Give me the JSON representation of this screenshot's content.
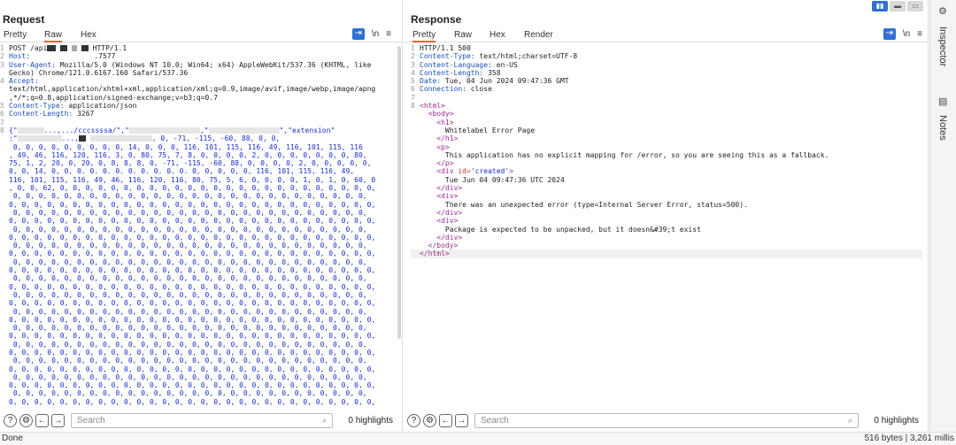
{
  "request": {
    "title": "Request",
    "tabs": [
      "Pretty",
      "Raw",
      "Hex"
    ],
    "active_tab": "Raw",
    "lines": [
      {
        "n": "1",
        "segments": [
          {
            "t": "POST /api"
          },
          {
            "redact": 10
          },
          {
            "t": " "
          },
          {
            "redact": 8
          },
          {
            "t": " "
          },
          {
            "redact": 6,
            "light": true
          },
          {
            "t": " "
          },
          {
            "redact": 8
          },
          {
            "t": " HTTP/1.1"
          }
        ]
      },
      {
        "n": "2",
        "segments": [
          {
            "t": "Host: ",
            "cls": "kh"
          },
          {
            "t": "              .7577"
          }
        ]
      },
      {
        "n": "3",
        "segments": [
          {
            "t": "User-Agent: ",
            "cls": "kh"
          },
          {
            "t": "Mozilla/5.0 (Windows NT 10.0; Win64; x64) AppleWebKit/537.36 (KHTML, like"
          }
        ]
      },
      {
        "n": "",
        "segments": [
          {
            "t": "Gecko) Chrome/121.0.6167.160 Safari/537.36"
          }
        ]
      },
      {
        "n": "4",
        "segments": [
          {
            "t": "Accept:",
            "cls": "kh"
          }
        ]
      },
      {
        "n": "",
        "segments": [
          {
            "t": "text/html,application/xhtml+xml,application/xml;q=0.9,image/avif,image/webp,image/apng"
          }
        ]
      },
      {
        "n": "",
        "segments": [
          {
            "t": ",*/*;q=0.8,application/signed-exchange;v=b3;q=0.7"
          }
        ]
      },
      {
        "n": "5",
        "segments": [
          {
            "t": "Content-Type: ",
            "cls": "kh"
          },
          {
            "t": "application/json"
          }
        ]
      },
      {
        "n": "6",
        "segments": [
          {
            "t": "Content-Length: ",
            "cls": "kh"
          },
          {
            "t": "3267"
          }
        ]
      },
      {
        "n": "7",
        "segments": []
      },
      {
        "n": "8",
        "segments": [
          {
            "t": "{\"",
            "cls": "blue"
          },
          {
            "redact": 30,
            "white": true
          },
          {
            "t": "...,.../cccssssa/\",\"",
            "cls": "blue"
          },
          {
            "redact": 80,
            "white": true
          },
          {
            "t": ",\"",
            "cls": "blue"
          },
          {
            "redact": 80,
            "white": true
          },
          {
            "t": "\",\"extension\"",
            "cls": "blue"
          }
        ]
      },
      {
        "n": "",
        "segments": [
          {
            "t": ":\"",
            "cls": "blue"
          },
          {
            "redact": 50,
            "white": true
          },
          {
            "t": "...,",
            "cls": "blue"
          },
          {
            "redact": 8
          },
          {
            "t": " ",
            "cls": "blue"
          },
          {
            "redact": 70,
            "white": true
          },
          {
            "t": ", 0, -71, -115, -60, 88, 0, 0,",
            "cls": "blue"
          }
        ]
      },
      {
        "n": "",
        "segments": [
          {
            "t": " 0, 0, 0, 0, 0, 0, 0, 0, 0, 14, 0, 0, 0, 116, 101, 115, 116, 49, 116, 101, 115, 116",
            "cls": "blue"
          }
        ]
      },
      {
        "n": "",
        "segments": [
          {
            "t": ", 49, 46, 116, 120, 116, 3, 0, 80, 75, 7, 8, 0, 0, 0, 0, 2, 0, 0, 0, 0, 0, 0, 0, 80,",
            "cls": "blue"
          }
        ]
      },
      {
        "n": "",
        "segments": [
          {
            "t": "75, 1, 2, 20, 0, 20, 0, 8, 8, 8, 0, -71, -115, -60, 88, 0, 0, 0, 0, 2, 0, 0, 0, 0, 0,",
            "cls": "blue"
          }
        ]
      },
      {
        "n": "",
        "segments": [
          {
            "t": "0, 0, 14, 0, 0, 0. 0. 0. 0. 0. 0. 0. 0. 0. 0, 0, 0, 0, 0, 116, 101, 115, 116, 49,",
            "cls": "blue"
          }
        ]
      },
      {
        "n": "",
        "segments": [
          {
            "t": "116, 101, 115, 116, 49, 46, 116, 120, 116, 80, 75, 5, 6, 0, 0, 0, 0, 1, 0, 1, 0, 60, 0",
            "cls": "blue"
          }
        ]
      },
      {
        "n": "",
        "segments": [
          {
            "t": ", 0, 0, 62, 0, 0, 0, 0, 0, 0, 0, 0, 0, 0, 0, 0, 0, 0, 0, 0, 0, 0, 0, 0, 0, 0, 0, 0, 0,",
            "cls": "blue"
          }
        ]
      },
      {
        "n": "",
        "segments": [
          {
            "t": " 0, 0, 0, 0, 0, 0, 0, 0, 0, 0, 0, 0, 0, 0, 0, 0, 0, 0, 0, 0, 0, 0, 0, 0, 0, 0, 0, 0,",
            "cls": "blue"
          }
        ]
      },
      {
        "n": "",
        "segments": [
          {
            "t": "0, 0, 0, 0, 0, 0, 0, 0, 0, 0, 0, 0, 0, 0, 0, 0, 0, 0, 0, 0, 0, 0, 0, 0, 0, 0, 0, 0, 0,",
            "cls": "blue"
          }
        ]
      },
      {
        "n": "",
        "segments": [
          {
            "t": " 0, 0, 0, 0, 0, 0, 0, 0, 0, 0, 0, 0, 0, 0, 0, 0, 0, 0, 0, 0, 0, 0, 0, 0, 0, 0, 0, 0,",
            "cls": "blue"
          }
        ]
      },
      {
        "n": "",
        "segments": [
          {
            "t": "0, 0, 0, 0, 0, 0, 0, 0, 0, 0, 0, 0, 0, 0, 0, 0, 0, 0, 0, 0, 0, 0, 0, 0, 0, 0, 0, 0, 0,",
            "cls": "blue"
          }
        ]
      },
      {
        "n": "",
        "segments": [
          {
            "t": " 0, 0, 0, 0, 0, 0, 0, 0, 0, 0, 0, 0, 0, 0, 0, 0, 0, 0, 0, 0, 0, 0, 0, 0, 0, 0, 0, 0,",
            "cls": "blue"
          }
        ]
      },
      {
        "n": "",
        "segments": [
          {
            "t": "0, 0, 0, 0, 0, 0, 0, 0, 0, 0, 0, 0, 0, 0, 0, 0, 0, 0, 0, 0, 0, 0, 0, 0, 0, 0, 0, 0, 0,",
            "cls": "blue"
          }
        ]
      },
      {
        "n": "",
        "segments": [
          {
            "t": " 0, 0, 0, 0, 0, 0, 0, 0, 0, 0, 0, 0, 0, 0, 0, 0, 0, 0, 0, 0, 0, 0, 0, 0, 0, 0, 0, 0,",
            "cls": "blue"
          }
        ]
      },
      {
        "n": "",
        "segments": [
          {
            "t": "0, 0, 0, 0, 0, 0, 0, 0, 0, 0, 0, 0, 0, 0, 0, 0, 0, 0, 0, 0, 0, 0, 0, 0, 0, 0, 0, 0, 0,",
            "cls": "blue"
          }
        ]
      },
      {
        "n": "",
        "segments": [
          {
            "t": " 0, 0, 0, 0, 0, 0, 0, 0, 0, 0, 0, 0, 0, 0, 0, 0, 0, 0, 0, 0, 0, 0, 0, 0, 0, 0, 0, 0,",
            "cls": "blue"
          }
        ]
      },
      {
        "n": "",
        "segments": [
          {
            "t": "0, 0, 0, 0, 0, 0, 0, 0, 0, 0, 0, 0, 0, 0, 0, 0, 0, 0, 0, 0, 0, 0, 0, 0, 0, 0, 0, 0, 0,",
            "cls": "blue"
          }
        ]
      },
      {
        "n": "",
        "segments": [
          {
            "t": " 0, 0, 0, 0, 0, 0, 0, 0, 0, 0, 0, 0, 0, 0, 0, 0, 0, 0, 0, 0, 0, 0, 0, 0, 0, 0, 0, 0,",
            "cls": "blue"
          }
        ]
      },
      {
        "n": "",
        "segments": [
          {
            "t": "0, 0, 0, 0, 0, 0, 0, 0, 0, 0, 0, 0, 0, 0, 0, 0, 0, 0, 0, 0, 0, 0, 0, 0, 0, 0, 0, 0, 0,",
            "cls": "blue"
          }
        ]
      },
      {
        "n": "",
        "segments": [
          {
            "t": " 0, 0, 0, 0, 0, 0, 0, 0, 0, 0, 0, 0, 0, 0, 0, 0, 0, 0, 0, 0, 0, 0, 0, 0, 0, 0, 0, 0,",
            "cls": "blue"
          }
        ]
      },
      {
        "n": "",
        "segments": [
          {
            "t": "0, 0, 0, 0, 0, 0, 0, 0, 0, 0, 0, 0, 0, 0, 0, 0, 0, 0, 0, 0, 0, 0, 0, 0, 0, 0, 0, 0, 0,",
            "cls": "blue"
          }
        ]
      },
      {
        "n": "",
        "segments": [
          {
            "t": " 0, 0, 0, 0, 0, 0, 0, 0, 0, 0, 0, 0, 0, 0, 0, 0, 0, 0, 0, 0, 0, 0, 0, 0, 0, 0, 0, 0,",
            "cls": "blue"
          }
        ]
      },
      {
        "n": "",
        "segments": [
          {
            "t": "0, 0, 0, 0, 0, 0, 0, 0, 0, 0, 0, 0, 0, 0, 0, 0, 0, 0, 0, 0, 0, 0, 0, 0, 0, 0, 0, 0, 0,",
            "cls": "blue"
          }
        ]
      },
      {
        "n": "",
        "segments": [
          {
            "t": " 0, 0, 0, 0, 0, 0, 0, 0, 0, 0, 0, 0, 0, 0, 0, 0, 0, 0, 0, 0, 0, 0, 0, 0, 0, 0, 0, 0,",
            "cls": "blue"
          }
        ]
      },
      {
        "n": "",
        "segments": [
          {
            "t": "0, 0, 0, 0, 0, 0, 0, 0, 0, 0, 0, 0, 0, 0, 0, 0, 0, 0, 0, 0, 0, 0, 0, 0, 0, 0, 0, 0, 0,",
            "cls": "blue"
          }
        ]
      },
      {
        "n": "",
        "segments": [
          {
            "t": " 0, 0, 0, 0, 0, 0, 0, 0, 0, 0, 0, 0, 0, 0, 0, 0, 0, 0, 0, 0, 0, 0, 0, 0, 0, 0, 0, 0,",
            "cls": "blue"
          }
        ]
      },
      {
        "n": "",
        "segments": [
          {
            "t": "0, 0, 0, 0, 0, 0, 0, 0, 0, 0, 0, 0, 0, 0, 0, 0, 0, 0, 0, 0, 0, 0, 0, 0, 0, 0, 0, 0, 0,",
            "cls": "blue"
          }
        ]
      },
      {
        "n": "",
        "segments": [
          {
            "t": " 0, 0, 0, 0, 0, 0, 0, 0, 0, 0, 0, 0, 0, 0, 0, 0, 0, 0, 0, 0, 0, 0, 0, 0, 0, 0, 0, 0,",
            "cls": "blue"
          }
        ]
      },
      {
        "n": "",
        "segments": [
          {
            "t": "0, 0, 0, 0, 0, 0, 0, 0, 0, 0, 0, 0, 0, 0, 0, 0, 0, 0, 0, 0, 0, 0, 0, 0, 0, 0, 0, 0, 0,",
            "cls": "blue"
          }
        ]
      },
      {
        "n": "",
        "segments": [
          {
            "t": " 0, 0, 0, 0, 0, 0, 0, 0, 0, 0, 0, 0, 0, 0, 0, 0, 0, 0, 0, 0, 0, 0, 0, 0, 0, 0, 0, 0,",
            "cls": "blue"
          }
        ]
      },
      {
        "n": "",
        "segments": [
          {
            "t": "0, 0, 0, 0, 0, 0, 0, 0, 0, 0, 0, 0, 0, 0, 0, 0, 0, 0, 0, 0, 0, 0, 0, 0, 0, 0, 0, 0, 0,",
            "cls": "blue"
          }
        ]
      },
      {
        "n": "",
        "segments": [
          {
            "t": " 0, 0, 0, 0, 0, 0, 0, 0, 0, 0, 0, 0, 0, 0, 0, 0, 0, 0, 0, 0, 0, 0, 0, 0, 0, 0, 0, 0,",
            "cls": "blue"
          }
        ]
      },
      {
        "n": "",
        "segments": [
          {
            "t": "0, 0, 0, 0, 0, 0, 0, 0, 0, 0, 0, 0, 0, 0, 0, 0, 0, 0, 0, 0, 0, 0, 0, 0, 0, 0, 0, 0, 0,",
            "cls": "blue"
          }
        ]
      }
    ],
    "search_placeholder": "Search",
    "highlights": "0 highlights"
  },
  "response": {
    "title": "Response",
    "tabs": [
      "Pretty",
      "Raw",
      "Hex",
      "Render"
    ],
    "active_tab": "Pretty",
    "lines": [
      {
        "n": "1",
        "segments": [
          {
            "t": "HTTP/1.1 500"
          }
        ]
      },
      {
        "n": "2",
        "segments": [
          {
            "t": "Content-Type: ",
            "cls": "kh"
          },
          {
            "t": "text/html;charset=UTF-8"
          }
        ]
      },
      {
        "n": "3",
        "segments": [
          {
            "t": "Content-Language: ",
            "cls": "kh"
          },
          {
            "t": "en-US"
          }
        ]
      },
      {
        "n": "4",
        "segments": [
          {
            "t": "Content-Length: ",
            "cls": "kh"
          },
          {
            "t": "358"
          }
        ]
      },
      {
        "n": "5",
        "segments": [
          {
            "t": "Date: ",
            "cls": "kh"
          },
          {
            "t": "Tue, 04 Jun 2024 09:47:36 GMT"
          }
        ]
      },
      {
        "n": "6",
        "segments": [
          {
            "t": "Connection: ",
            "cls": "kh"
          },
          {
            "t": "close"
          }
        ]
      },
      {
        "n": "7",
        "segments": []
      },
      {
        "n": "8",
        "segments": [
          {
            "t": "<html>",
            "cls": "tag"
          }
        ]
      },
      {
        "n": "",
        "segments": [
          {
            "t": "  "
          },
          {
            "t": "<body>",
            "cls": "tag"
          }
        ]
      },
      {
        "n": "",
        "segments": [
          {
            "t": "    "
          },
          {
            "t": "<h1>",
            "cls": "tag"
          }
        ]
      },
      {
        "n": "",
        "segments": [
          {
            "t": "      Whitelabel Error Page"
          }
        ]
      },
      {
        "n": "",
        "segments": [
          {
            "t": "    "
          },
          {
            "t": "</h1>",
            "cls": "tag"
          }
        ]
      },
      {
        "n": "",
        "segments": [
          {
            "t": "    "
          },
          {
            "t": "<p>",
            "cls": "tag"
          }
        ]
      },
      {
        "n": "",
        "segments": [
          {
            "t": "      This application has no explicit mapping for /error, so you are seeing this as a fallback."
          }
        ]
      },
      {
        "n": "",
        "segments": [
          {
            "t": "    "
          },
          {
            "t": "</p>",
            "cls": "tag"
          }
        ]
      },
      {
        "n": "",
        "segments": [
          {
            "t": "    "
          },
          {
            "t": "<div ",
            "cls": "tag"
          },
          {
            "t": "id=",
            "cls": "attr"
          },
          {
            "t": "'created'",
            "cls": "str"
          },
          {
            "t": ">",
            "cls": "tag"
          }
        ]
      },
      {
        "n": "",
        "segments": [
          {
            "t": "      Tue Jun 04 09:47:36 UTC 2024"
          }
        ]
      },
      {
        "n": "",
        "segments": [
          {
            "t": "    "
          },
          {
            "t": "</div>",
            "cls": "tag"
          }
        ]
      },
      {
        "n": "",
        "segments": [
          {
            "t": "    "
          },
          {
            "t": "<div>",
            "cls": "tag"
          }
        ]
      },
      {
        "n": "",
        "segments": [
          {
            "t": "      There was an unexpected error (type=Internal Server Error, status=500)."
          }
        ]
      },
      {
        "n": "",
        "segments": [
          {
            "t": "    "
          },
          {
            "t": "</div>",
            "cls": "tag"
          }
        ]
      },
      {
        "n": "",
        "segments": [
          {
            "t": "    "
          },
          {
            "t": "<div>",
            "cls": "tag"
          }
        ]
      },
      {
        "n": "",
        "segments": [
          {
            "t": "      Package is expected to be unpacked, but it doesn&#39;t exist"
          }
        ]
      },
      {
        "n": "",
        "segments": [
          {
            "t": "    "
          },
          {
            "t": "</div>",
            "cls": "tag"
          }
        ]
      },
      {
        "n": "",
        "segments": [
          {
            "t": "  "
          },
          {
            "t": "</body>",
            "cls": "tag"
          }
        ]
      },
      {
        "n": "",
        "segments": [
          {
            "t": "</html>",
            "cls": "tag"
          }
        ],
        "highlight": true
      }
    ],
    "search_placeholder": "Search",
    "highlights": "0 highlights"
  },
  "toolbar": {
    "wrap_glyph": "⇥",
    "newline_glyph": "\\n",
    "menu_glyph": "≡"
  },
  "search_buttons": {
    "help": "?",
    "settings": "⚙",
    "prev": "←",
    "next": "→",
    "search": "⌕"
  },
  "sidebar": {
    "inspector_label": "Inspector",
    "notes_label": "Notes"
  },
  "status": {
    "left": "Done",
    "right": "516 bytes | 3,261 millis"
  },
  "colors": {
    "accent": "#2f6fd6",
    "tab_active": "#e8623b",
    "header_key": "#1a4fb5",
    "body_text": "#1a2dc9",
    "tag": "#9b2c8f"
  }
}
